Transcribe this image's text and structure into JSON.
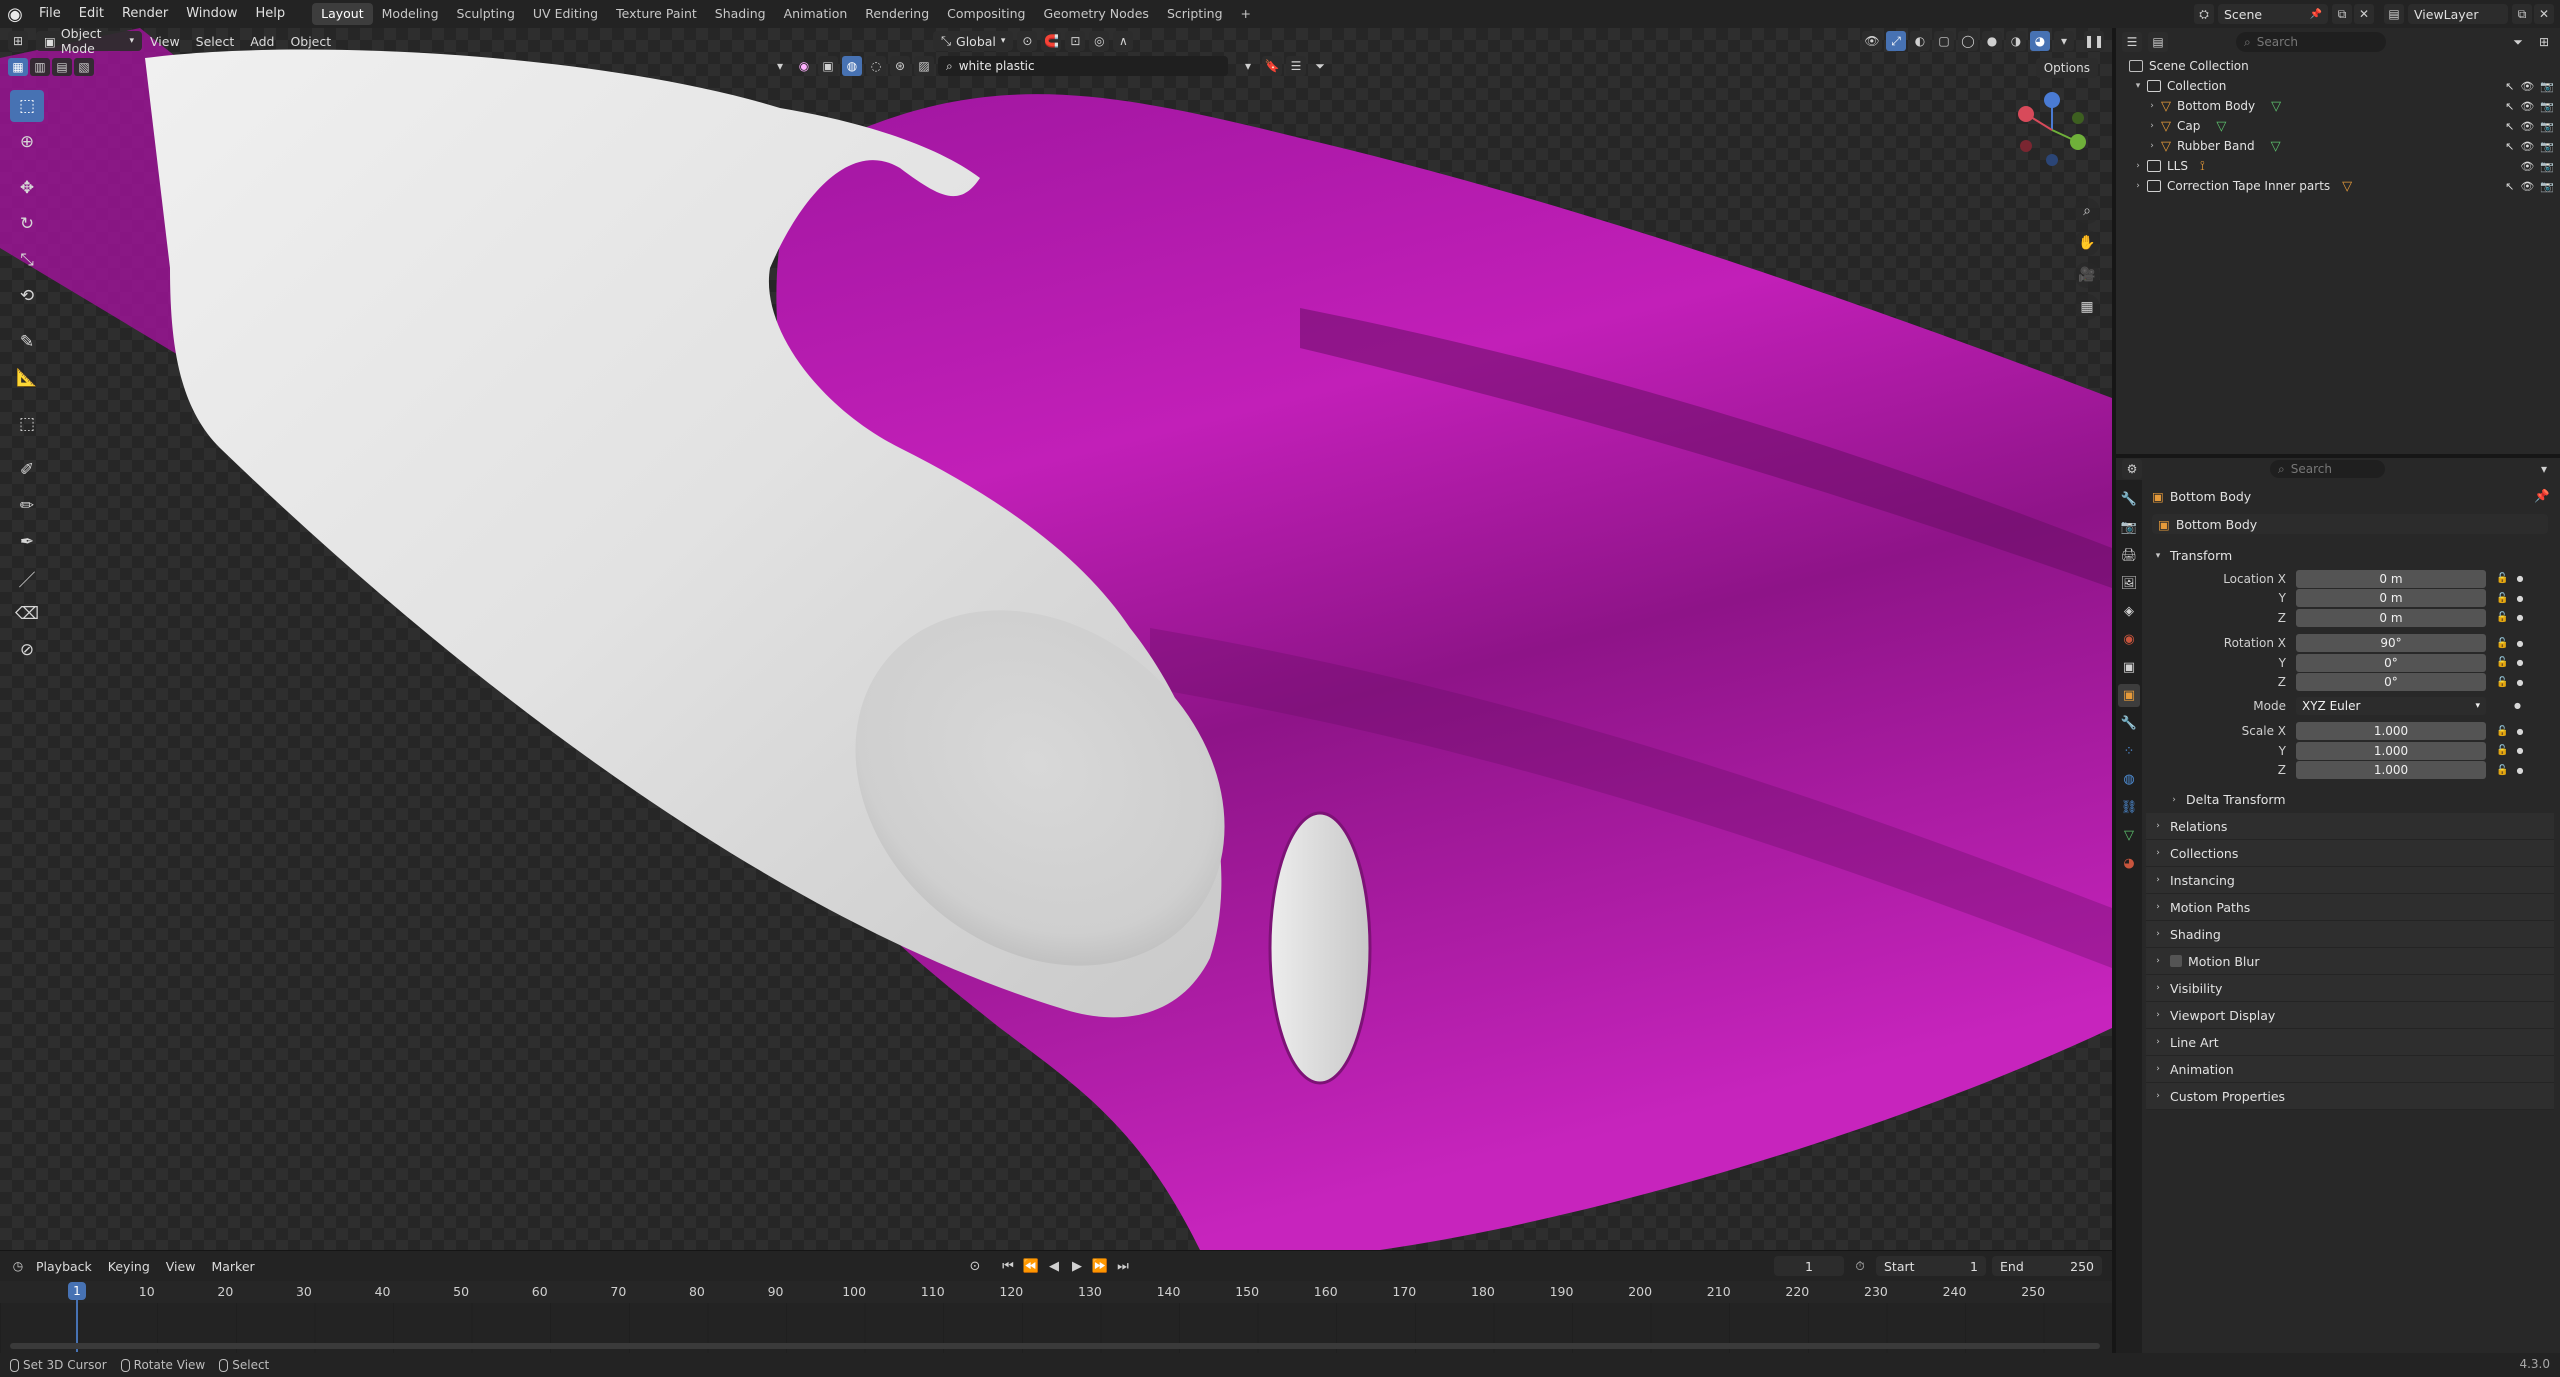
{
  "topbar": {
    "menus": [
      "File",
      "Edit",
      "Render",
      "Window",
      "Help"
    ],
    "workspaces": [
      "Layout",
      "Modeling",
      "Sculpting",
      "UV Editing",
      "Texture Paint",
      "Shading",
      "Animation",
      "Rendering",
      "Compositing",
      "Geometry Nodes",
      "Scripting"
    ],
    "active_workspace": "Layout",
    "add_tab": "+",
    "scene": "Scene",
    "view_layer": "ViewLayer"
  },
  "viewport": {
    "mode": "Object Mode",
    "menus": [
      "View",
      "Select",
      "Add",
      "Object"
    ],
    "transform_orientation": "Global",
    "search_value": "white plastic",
    "options_label": "Options"
  },
  "timeline": {
    "menus": [
      "Playback",
      "Keying",
      "View",
      "Marker"
    ],
    "current_frame": "1",
    "start_label": "Start",
    "start": "1",
    "end_label": "End",
    "end": "250",
    "ruler_marks": [
      "10",
      "20",
      "30",
      "40",
      "50",
      "60",
      "70",
      "80",
      "90",
      "100",
      "110",
      "120",
      "130",
      "140",
      "150",
      "160",
      "170",
      "180",
      "190",
      "200",
      "210",
      "220",
      "230",
      "240",
      "250"
    ],
    "playhead_label": "1"
  },
  "statusbar": {
    "items": [
      "Set 3D Cursor",
      "Rotate View",
      "Select"
    ],
    "version": "4.3.0"
  },
  "outliner": {
    "search_placeholder": "Search",
    "rows": {
      "scene_collection": "Scene Collection",
      "collection": "Collection",
      "bottom_body": "Bottom Body",
      "cap": "Cap",
      "rubber_band": "Rubber Band",
      "lls": "LLS",
      "correction_tape": "Correction Tape Inner parts"
    }
  },
  "properties": {
    "search_placeholder": "Search",
    "object_name": "Bottom Body",
    "data_name": "Bottom Body",
    "transform": {
      "title": "Transform",
      "location_label": "Location X",
      "location": [
        "0 m",
        "0 m",
        "0 m"
      ],
      "rotation_label": "Rotation X",
      "rotation": [
        "90°",
        "0°",
        "0°"
      ],
      "mode_label": "Mode",
      "mode": "XYZ Euler",
      "scale_label": "Scale X",
      "scale": [
        "1.000",
        "1.000",
        "1.000"
      ],
      "y_label": "Y",
      "z_label": "Z"
    },
    "delta_transform": "Delta Transform",
    "panels": [
      "Relations",
      "Collections",
      "Instancing",
      "Motion Paths",
      "Shading",
      "Motion Blur",
      "Visibility",
      "Viewport Display",
      "Line Art",
      "Animation",
      "Custom Properties"
    ]
  },
  "colors": {
    "accent": "#4772b3",
    "magenta_material": "#c020b8",
    "white_plastic": "#e6e6e6",
    "object_orange": "#e59a3a",
    "mesh_green": "#5dc16d"
  }
}
